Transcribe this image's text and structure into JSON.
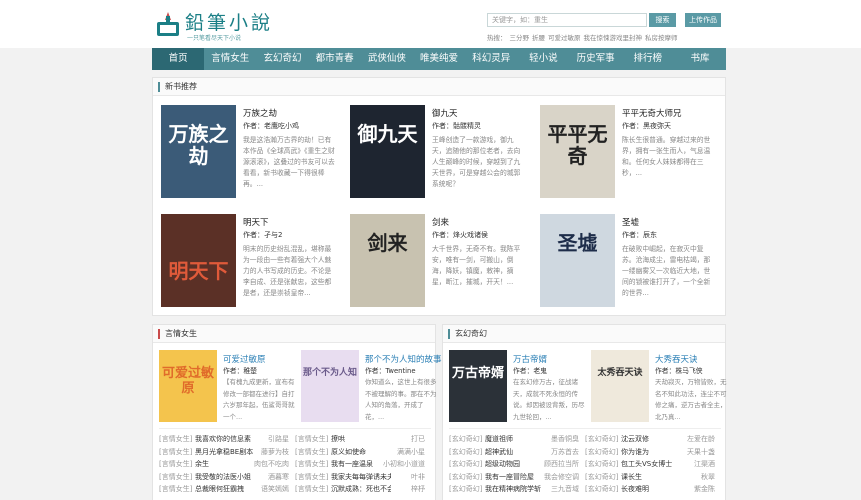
{
  "header": {
    "logo_title": "鉛筆小說",
    "logo_sub": "一只笔看尽天下小说",
    "search_placeholder": "关键字，如：重生",
    "search_label": "搜索",
    "upload_label": "上传作品",
    "hot_label": "热搜：",
    "hot_items": [
      "三分野",
      "折腰",
      "可爱过敏原",
      "我在惊悚游戏里封神",
      "私房按摩师"
    ]
  },
  "nav": {
    "items": [
      "首页",
      "言情女生",
      "玄幻奇幻",
      "都市青春",
      "武侠仙侠",
      "唯美纯爱",
      "科幻灵异",
      "轻小说",
      "历史军事",
      "排行榜",
      "书库"
    ]
  },
  "new_books": {
    "title": "新书推荐",
    "books": [
      {
        "title": "万族之劫",
        "author": "作者：老鹰吃小鸡",
        "desc": "我是这浩瀚万古界的劫！已有本作品《全球高武》《重生之财源滚滚》，这叠过的书友可以去看看，新书收藏一下得很棒再。...",
        "cover_text": "万族之劫",
        "cover_color": "#3b5b78"
      },
      {
        "title": "御九天",
        "author": "作者：骷髅精灵",
        "desc": "王峰创造了一款游戏，御九天，追随他的那位老者，去向人生巅峰的时候，穿越到了九天世界，可是穿越公会的城郭系统呢？",
        "cover_text": "御九天",
        "cover_color": "#1e2530"
      },
      {
        "title": "平平无奇大师兄",
        "author": "作者：黑夜弥天",
        "desc": "陈长生很普通。穿越过来的世界，拥有一张生而人，气息温和。任何女人妹妹都得在三秒，...",
        "cover_text": "平平无奇",
        "cover_color": "#d9d4c8"
      },
      {
        "title": "明天下",
        "author": "作者：孑与2",
        "desc": "明末的历史纷乱混乱，堪称最为一段由一些有着强大个人魅力的人书写成的历史。不论是李自成、还是张献忠，这些都是者，还是崇祯皇帝...",
        "cover_text": "明天下",
        "cover_color": "#5b3026"
      },
      {
        "title": "剑来",
        "author": "作者：烽火戏诸侯",
        "desc": "大千世界，无奇不有。我陈平安，唯有一剑，可搬山，倒海，降妖，镇魔，敕神，摘星，断江，摧城，开天！...",
        "cover_text": "剑来",
        "cover_color": "#c8c2b0"
      },
      {
        "title": "圣墟",
        "author": "作者：辰东",
        "desc": "在破败中崛起，在寂灭中复苏。沧海成尘，雷电枯竭，那一缕幽雾又一次临近大地，世间的锁被谁打开了，一个全新的世界...",
        "cover_text": "圣墟",
        "cover_color": "#cfd8e0"
      }
    ]
  },
  "yanqing": {
    "title": "言情女生",
    "featured": [
      {
        "title": "可爱过敏原",
        "author": "作者：稚楚",
        "desc": "【有槐九成更新，宣布有修改一部都在进行】自打六岁那年起，伍鲨哥哥就一个...",
        "cover_text": "可爱过敏原",
        "cover_color": "#f4c44d"
      },
      {
        "title": "那个不为人知的故事",
        "author": "作者：Twentine",
        "desc": "你知道么，这世上有很多不被理解的事。那在不为人知的角落，开成了花，...",
        "cover_text": "那个不为人知",
        "cover_color": "#e8ddf0"
      }
    ],
    "list": [
      {
        "cat": "[言情女生]",
        "name": "我喜欢你的信息素",
        "author": "引路星"
      },
      {
        "cat": "[言情女生]",
        "name": "撩哄",
        "author": "打已"
      },
      {
        "cat": "[言情女生]",
        "name": "黑月光拿稳BE剧本",
        "author": "藤萝为枝"
      },
      {
        "cat": "[言情女生]",
        "name": "原义如使命",
        "author": "满满小星"
      },
      {
        "cat": "[言情女生]",
        "name": "余生",
        "author": "肉包不吃肉"
      },
      {
        "cat": "[言情女生]",
        "name": "我有一座温泉",
        "author": "小初和小道道"
      },
      {
        "cat": "[言情女生]",
        "name": "我受敬的法医小姐",
        "author": "酒暮寒"
      },
      {
        "cat": "[言情女生]",
        "name": "我家夫每每弹诱未夫小",
        "author": "叶非"
      },
      {
        "cat": "[言情女生]",
        "name": "总裁眼何狂霸拽",
        "author": "语笑嫣嫣"
      },
      {
        "cat": "[言情女生]",
        "name": "沉默成熟：死也不会放",
        "author": "梓杼"
      }
    ]
  },
  "xuanhuan": {
    "title": "玄幻奇幻",
    "featured": [
      {
        "title": "万古帝婿",
        "author": "作者：老鬼",
        "desc": "在玄幻修万古，征战诸天，成就不死永恒的传说。却因被设背叛，历尽九世轮回，...",
        "cover_text": "万古帝婿",
        "cover_color": "#2b3138"
      },
      {
        "title": "大秀吞天诀",
        "author": "作者：株马飞侠",
        "desc": "天劫寂灭，万物皆败，无名不知此功法，连尘不可修之痛，逆万古者全主，北乃真...",
        "cover_text": "太秀吞天诀",
        "cover_color": "#efe9dc"
      }
    ],
    "list": [
      {
        "cat": "[玄幻奇幻]",
        "name": "魔道祖师",
        "author": "墨香铜臭"
      },
      {
        "cat": "[玄幻奇幻]",
        "name": "沈云双修",
        "author": "左爱在龄"
      },
      {
        "cat": "[玄幻奇幻]",
        "name": "超神武仙",
        "author": "万苏首去"
      },
      {
        "cat": "[玄幻奇幻]",
        "name": "你为谁为",
        "author": "天果十盏"
      },
      {
        "cat": "[玄幻奇幻]",
        "name": "超级动物园",
        "author": "顾西拉当所"
      },
      {
        "cat": "[玄幻奇幻]",
        "name": "包工头VS女博士",
        "author": "江渠酒"
      },
      {
        "cat": "[玄幻奇幻]",
        "name": "我有一座冒险屋",
        "author": "我会修空调"
      },
      {
        "cat": "[玄幻奇幻]",
        "name": "课长生",
        "author": "秋翠"
      },
      {
        "cat": "[玄幻奇幻]",
        "name": "我在精神病院学斩",
        "author": "三九音域"
      },
      {
        "cat": "[玄幻奇幻]",
        "name": "长夜难明",
        "author": "紫金陈"
      }
    ]
  }
}
